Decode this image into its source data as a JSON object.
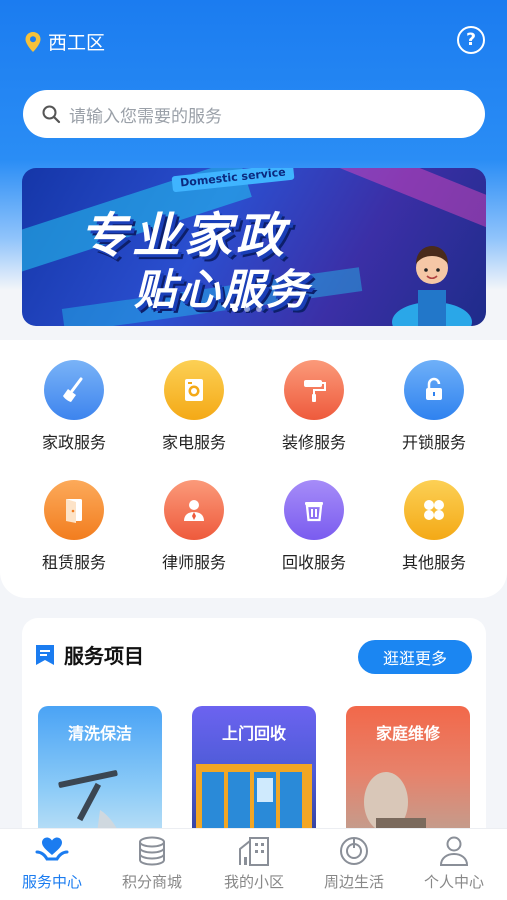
{
  "location": {
    "name": "西工区",
    "icon": "location-pin-icon"
  },
  "help_icon": "question-circle-icon",
  "search": {
    "placeholder": "请输入您需要的服务",
    "icon": "search-icon"
  },
  "banner": {
    "tag": "Domestic service",
    "line1": "专业家政",
    "line2": "贴心服务",
    "dots": 3,
    "active_dot": 0
  },
  "services": [
    {
      "label": "家政服务",
      "icon": "broom-icon",
      "color": "#4a8ef0"
    },
    {
      "label": "家电服务",
      "icon": "washing-machine-icon",
      "color": "#f5b21c"
    },
    {
      "label": "装修服务",
      "icon": "paint-roller-icon",
      "color": "#f2704f"
    },
    {
      "label": "开锁服务",
      "icon": "unlock-icon",
      "color": "#3d8ff3"
    },
    {
      "label": "租赁服务",
      "icon": "door-icon",
      "color": "#f58b2b"
    },
    {
      "label": "律师服务",
      "icon": "lawyer-icon",
      "color": "#f2704f"
    },
    {
      "label": "回收服务",
      "icon": "recycle-bin-icon",
      "color": "#8a6ef3"
    },
    {
      "label": "其他服务",
      "icon": "grid-icon",
      "color": "#f5b21c"
    }
  ],
  "projects": {
    "title": "服务项目",
    "more_label": "逛逛更多",
    "cards": [
      {
        "label": "清洗保洁"
      },
      {
        "label": "上门回收"
      },
      {
        "label": "家庭维修"
      }
    ]
  },
  "tabbar": [
    {
      "label": "服务中心",
      "icon": "heart-hands-icon",
      "active": true
    },
    {
      "label": "积分商城",
      "icon": "coins-stack-icon",
      "active": false
    },
    {
      "label": "我的小区",
      "icon": "building-icon",
      "active": false
    },
    {
      "label": "周边生活",
      "icon": "compass-icon",
      "active": false
    },
    {
      "label": "个人中心",
      "icon": "user-icon",
      "active": false
    }
  ],
  "colors": {
    "primary": "#1b7cf0",
    "bg": "#f3f5f9"
  }
}
